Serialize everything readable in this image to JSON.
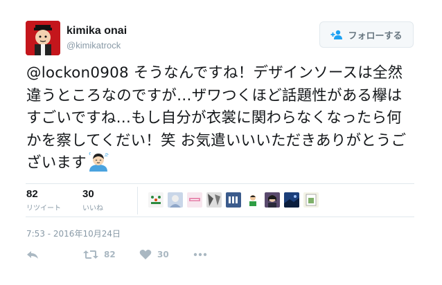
{
  "user": {
    "name": "kimika onai",
    "handle": "@kimikatrock"
  },
  "follow_button": {
    "label": "フォローする",
    "icon": "add-user-icon"
  },
  "tweet": {
    "mention": "@lockon0908",
    "text": " そうなんですね！デザインソースは全然違うところなのですが…ザワつくほど話題性がある欅はすごいですね…もし自分が衣裳に関わらなくなったら何かを察してくだい！笑 お気遣いいいただきありがとうございます",
    "emoji": "relieved-person-emoji"
  },
  "stats": {
    "retweets": {
      "count": "82",
      "label": "リツイート"
    },
    "likes": {
      "count": "30",
      "label": "いいね"
    }
  },
  "likers_count_shown": 9,
  "timestamp": "7:53 - 2016年10月24日",
  "actions": {
    "reply": {
      "icon": "reply-icon"
    },
    "retweet": {
      "icon": "retweet-icon",
      "count": "82"
    },
    "like": {
      "icon": "heart-icon",
      "count": "30"
    },
    "more": {
      "icon": "more-icon"
    }
  },
  "colors": {
    "text": "#14171a",
    "muted": "#8899a6",
    "action_gray": "#aab8c2",
    "follow_blue": "#1da1f2",
    "avatar_red": "#c4161c"
  }
}
